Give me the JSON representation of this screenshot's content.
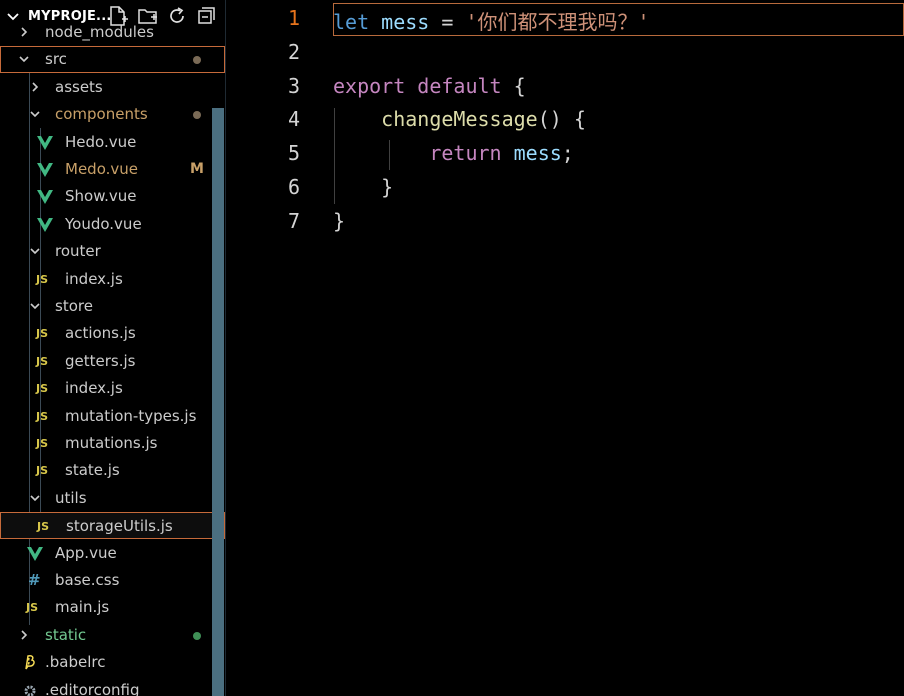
{
  "explorer": {
    "title": "MYPROJE...",
    "header_icons": [
      "new-file-icon",
      "new-folder-icon",
      "refresh-icon",
      "collapse-all-icon"
    ],
    "items": [
      {
        "label": "node_modules",
        "type": "folder",
        "state": "collapsed",
        "depth": 1
      },
      {
        "label": "src",
        "type": "folder",
        "state": "expanded",
        "depth": 1,
        "status": "modified-dot"
      },
      {
        "label": "assets",
        "type": "folder",
        "state": "collapsed",
        "depth": 2
      },
      {
        "label": "components",
        "type": "folder",
        "state": "expanded",
        "depth": 2,
        "status": "modified-dot"
      },
      {
        "label": "Hedo.vue",
        "type": "vue",
        "depth": 3
      },
      {
        "label": "Medo.vue",
        "type": "vue",
        "depth": 3,
        "badge": "M"
      },
      {
        "label": "Show.vue",
        "type": "vue",
        "depth": 3
      },
      {
        "label": "Youdo.vue",
        "type": "vue",
        "depth": 3
      },
      {
        "label": "router",
        "type": "folder",
        "state": "expanded",
        "depth": 2
      },
      {
        "label": "index.js",
        "type": "js",
        "depth": 3
      },
      {
        "label": "store",
        "type": "folder",
        "state": "expanded",
        "depth": 2
      },
      {
        "label": "actions.js",
        "type": "js",
        "depth": 3
      },
      {
        "label": "getters.js",
        "type": "js",
        "depth": 3
      },
      {
        "label": "index.js",
        "type": "js",
        "depth": 3
      },
      {
        "label": "mutation-types.js",
        "type": "js",
        "depth": 3
      },
      {
        "label": "mutations.js",
        "type": "js",
        "depth": 3
      },
      {
        "label": "state.js",
        "type": "js",
        "depth": 3
      },
      {
        "label": "utils",
        "type": "folder",
        "state": "expanded",
        "depth": 2
      },
      {
        "label": "storageUtils.js",
        "type": "js",
        "depth": 3,
        "selected": true
      },
      {
        "label": "App.vue",
        "type": "vue",
        "depth": 2
      },
      {
        "label": "base.css",
        "type": "css",
        "depth": 2
      },
      {
        "label": "main.js",
        "type": "js",
        "depth": 2
      },
      {
        "label": "static",
        "type": "folder",
        "state": "collapsed",
        "depth": 1,
        "status": "untracked-dot"
      },
      {
        "label": ".babelrc",
        "type": "babel",
        "depth": 1
      },
      {
        "label": ".editorconfig",
        "type": "config",
        "depth": 1
      }
    ],
    "icon_labels": {
      "js": "JS",
      "css": "#"
    },
    "badge_modified": "M"
  },
  "editor": {
    "line_numbers": [
      "1",
      "2",
      "3",
      "4",
      "5",
      "6",
      "7"
    ],
    "current_line": "1",
    "lines": [
      [
        {
          "t": "let",
          "c": "kw2"
        },
        {
          "t": " ",
          "c": "punc"
        },
        {
          "t": "mess",
          "c": "var"
        },
        {
          "t": " = ",
          "c": "punc"
        },
        {
          "t": "'你们都不理我吗？'",
          "c": "str"
        }
      ],
      [],
      [
        {
          "t": "export",
          "c": "kw"
        },
        {
          "t": " ",
          "c": "punc"
        },
        {
          "t": "default",
          "c": "kw"
        },
        {
          "t": " {",
          "c": "punc"
        }
      ],
      [
        {
          "t": "    ",
          "c": "punc"
        },
        {
          "t": "changeMessage",
          "c": "fn"
        },
        {
          "t": "() {",
          "c": "punc"
        }
      ],
      [
        {
          "t": "        ",
          "c": "punc"
        },
        {
          "t": "return",
          "c": "kw"
        },
        {
          "t": " ",
          "c": "punc"
        },
        {
          "t": "mess",
          "c": "var"
        },
        {
          "t": ";",
          "c": "punc"
        }
      ],
      [
        {
          "t": "    }",
          "c": "punc"
        }
      ],
      [
        {
          "t": "}",
          "c": "punc"
        }
      ]
    ]
  },
  "colors": {
    "accent_orange": "#c66a3a",
    "modified": "#c8a068",
    "untracked": "#3f8f56",
    "vue_green": "#41b883",
    "js_yellow": "#d7c64a",
    "css_blue": "#519aba",
    "babel_yellow": "#f5da55"
  }
}
